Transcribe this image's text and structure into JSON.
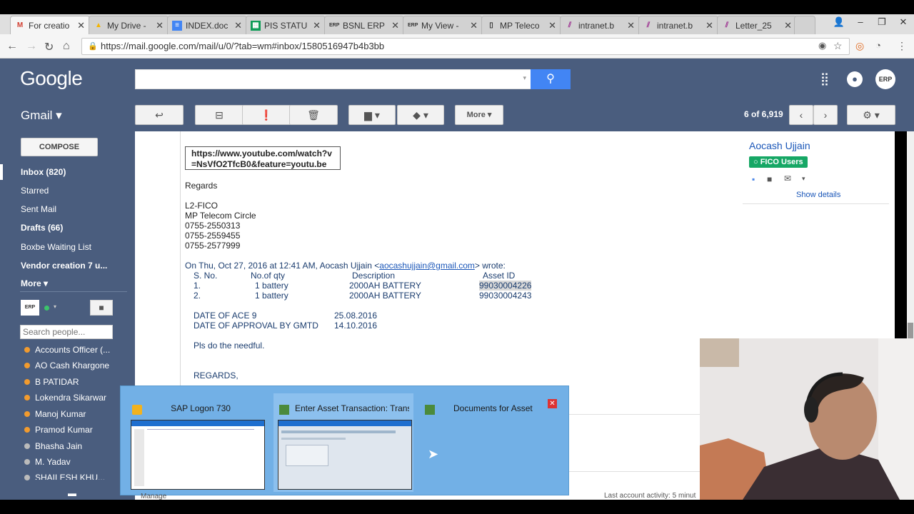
{
  "browser": {
    "tabs": [
      {
        "label": "For creatio",
        "icon": "gmail-icon",
        "active": true
      },
      {
        "label": "My Drive -",
        "icon": "drive-icon"
      },
      {
        "label": "INDEX.doc",
        "icon": "docs-icon"
      },
      {
        "label": "PIS STATU",
        "icon": "sheets-icon"
      },
      {
        "label": "BSNL ERP",
        "icon": "erp-icon"
      },
      {
        "label": "My View -",
        "icon": "erp-icon"
      },
      {
        "label": "MP Teleco",
        "icon": "page-icon"
      },
      {
        "label": "intranet.b",
        "icon": "intranet-icon"
      },
      {
        "label": "intranet.b",
        "icon": "intranet-icon"
      },
      {
        "label": "Letter_25",
        "icon": "intranet-icon"
      }
    ],
    "url": "https://mail.google.com/mail/u/0/?tab=wm#inbox/1580516947b4b3bb"
  },
  "gmail": {
    "logo": "Google",
    "app_label": "Gmail ▾",
    "pager": "6 of 6,919",
    "more_label": "More ▾",
    "compose_label": "COMPOSE",
    "nav": [
      {
        "label": "Inbox (820)",
        "bold": true
      },
      {
        "label": "Starred",
        "bold": false
      },
      {
        "label": "Sent Mail",
        "bold": false
      },
      {
        "label": "Drafts (66)",
        "bold": true
      },
      {
        "label": "Boxbe Waiting List",
        "bold": false
      },
      {
        "label": "Vendor creation 7 u...",
        "bold": true
      },
      {
        "label": "More ▾",
        "bold": true
      }
    ],
    "search_people_placeholder": "Search people...",
    "contacts": [
      {
        "name": "Accounts Officer (...",
        "status": "away"
      },
      {
        "name": "AO Cash Khargone",
        "status": "away"
      },
      {
        "name": "B PATIDAR",
        "status": "away"
      },
      {
        "name": "Lokendra Sikarwar",
        "status": "away"
      },
      {
        "name": "Manoj Kumar",
        "status": "away"
      },
      {
        "name": "Pramod Kumar",
        "status": "away"
      },
      {
        "name": "Bhasha Jain",
        "status": "offline"
      },
      {
        "name": "M. Yadav",
        "status": "offline"
      },
      {
        "name": "SHAILESH KHU...",
        "status": "offline"
      }
    ]
  },
  "message": {
    "youtube_link": "https://www.youtube.com/watch?v=NsVfO2TfcB0&feature=youtu.be",
    "regards": "Regards",
    "sig": [
      "L2-FICO",
      "MP Telecom Circle",
      "0755-2550313",
      "0755-2559455",
      "0755-2577999"
    ],
    "quote_header_prefix": "On Thu, Oct 27, 2016 at 12:41 AM, Aocash Ujjain <",
    "quote_email": "aocashujjain@gmail.com",
    "quote_header_suffix": "> wrote:",
    "table_headers": [
      "S. No.",
      "No.of qty",
      "Description",
      "Asset ID"
    ],
    "rows": [
      [
        "1.",
        "1 battery",
        "2000AH BATTERY",
        "99030004226"
      ],
      [
        "2.",
        "1 battery",
        "2000AH BATTERY",
        "99030004243"
      ]
    ],
    "date_ace_label": "DATE OF ACE 9",
    "date_ace": "25.08.2016",
    "date_approval_label": "DATE OF APPROVAL BY GMTD",
    "date_approval": "14.10.2016",
    "needful": "Pls do the needful.",
    "regards_caps": "REGARDS,",
    "last_activity": "Last account activity: 5 minut",
    "manage": "Manage"
  },
  "sender_card": {
    "name": "Aocash Ujjain",
    "group": "FICO Users",
    "show_details": "Show details"
  },
  "taskbar_preview": {
    "items": [
      {
        "title": "SAP Logon 730"
      },
      {
        "title": "Enter Asset Transaction: Transfe..."
      },
      {
        "title": "Documents for Asset"
      }
    ]
  }
}
